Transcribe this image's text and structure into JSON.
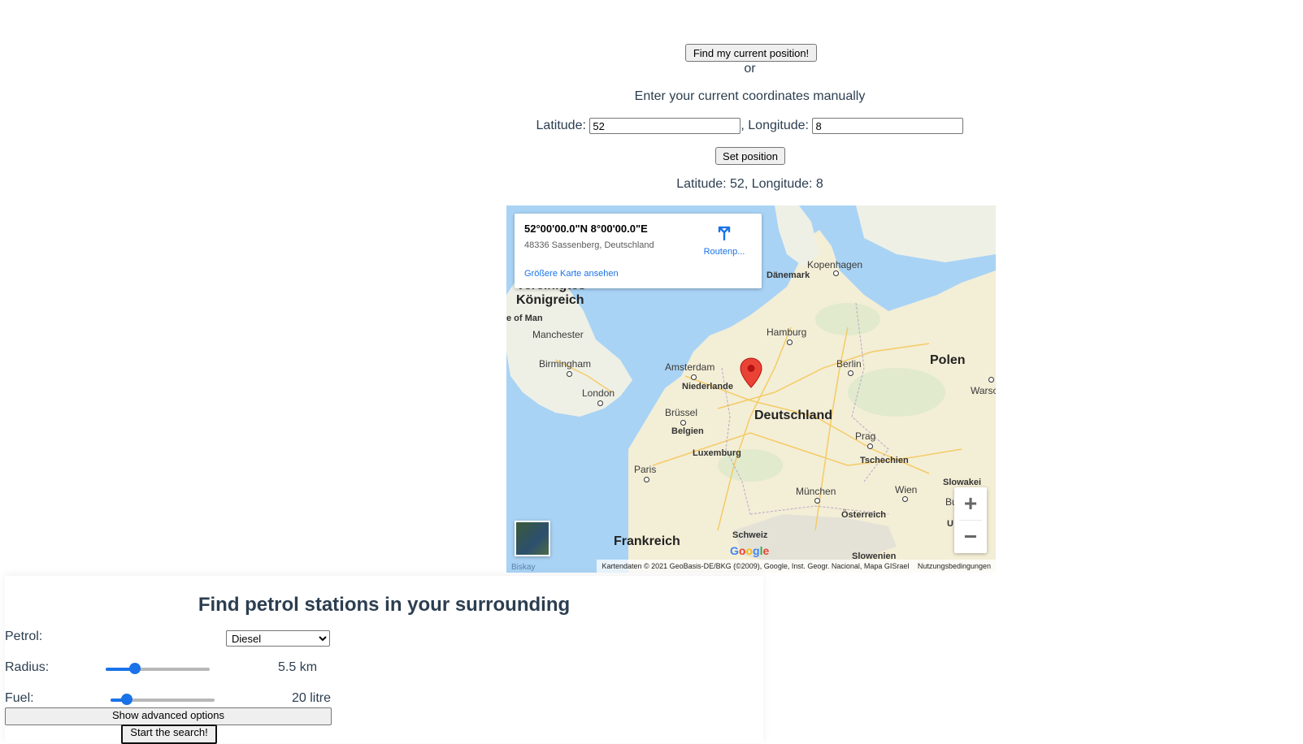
{
  "location": {
    "find_button": "Find my current position!",
    "or_text": "or",
    "manual_text": "Enter your current coordinates manually",
    "latitude_label": "Latitude:",
    "latitude_value": "52",
    "longitude_label": ", Longitude:",
    "longitude_value": "8",
    "set_button": "Set position",
    "current_position_text": "Latitude: 52, Longitude: 8"
  },
  "map": {
    "card": {
      "coords": "52°00'00.0\"N 8°00'00.0\"E",
      "address": "48336 Sassenberg, Deutschland",
      "larger_map_link": "Größere Karte ansehen",
      "route_label": "Routenp..."
    },
    "labels": {
      "uk1": "Vereinigtes",
      "uk2": "Königreich",
      "isle_of_man": "e of Man",
      "manchester": "Manchester",
      "birmingham": "Birmingham",
      "london": "London",
      "amsterdam": "Amsterdam",
      "niederlande": "Niederlande",
      "bruessel": "Brüssel",
      "belgien": "Belgien",
      "luxemburg": "Luxemburg",
      "paris": "Paris",
      "frankreich": "Frankreich",
      "schweiz": "Schweiz",
      "deutschland": "Deutschland",
      "hamburg": "Hamburg",
      "berlin": "Berlin",
      "polen": "Polen",
      "warsaw": "Warsc",
      "daenemark": "Dänemark",
      "kopenhagen": "Kopenhagen",
      "prag": "Prag",
      "tschechien": "Tschechien",
      "muenchen": "München",
      "wien": "Wien",
      "oesterreich": "Österreich",
      "slowakei": "Slowakei",
      "buda": "Buda",
      "slowenien": "Slowenien",
      "u": "U",
      "biskay": "Biskay"
    },
    "zoom_in": "+",
    "zoom_out": "−",
    "google_logo": "Google",
    "attribution": "Kartendaten © 2021 GeoBasis-DE/BKG (©2009), Google, Inst. Geogr. Nacional, Mapa GISrael",
    "terms": "Nutzungsbedingungen",
    "marker_color": "#ea4335"
  },
  "search_panel": {
    "title": "Find petrol stations in your surrounding",
    "petrol_label": "Petrol:",
    "petrol_selected": "Diesel",
    "radius_label": "Radius:",
    "radius_value": "5.5 km",
    "radius_fraction": 0.28,
    "fuel_label": "Fuel:",
    "fuel_value": "20 litre",
    "fuel_fraction": 0.16,
    "advanced_button": "Show advanced options",
    "start_button": "Start the search!"
  }
}
